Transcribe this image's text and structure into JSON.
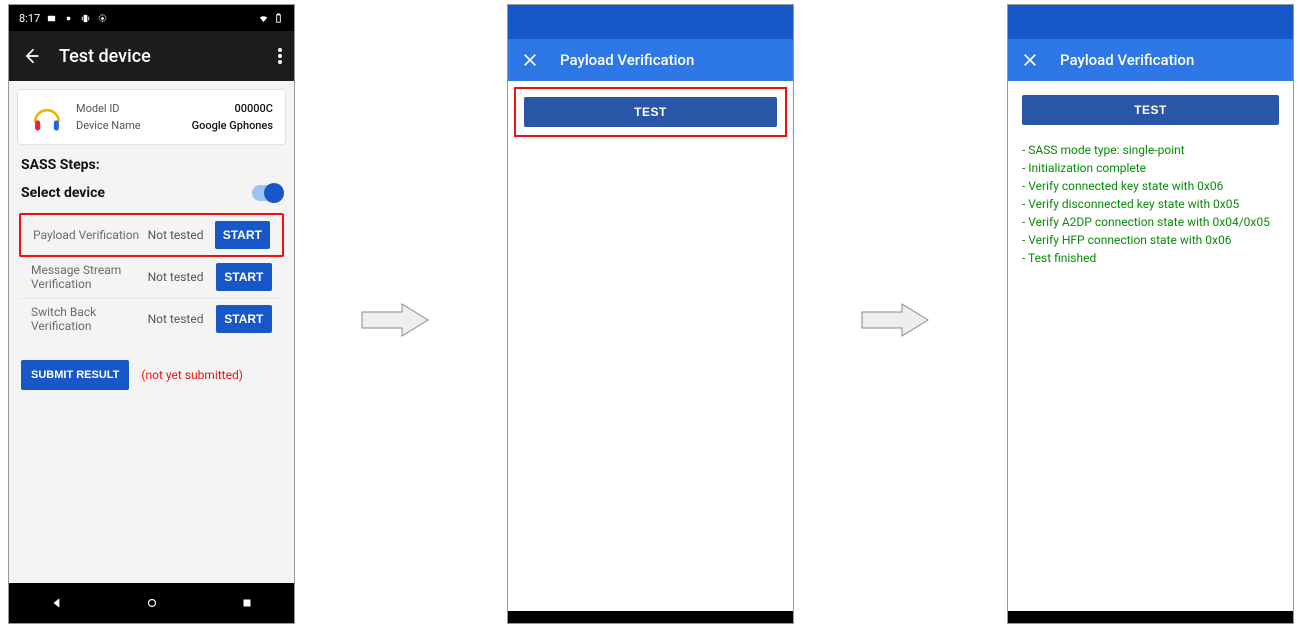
{
  "statusbar": {
    "time": "8:17"
  },
  "titlebar": {
    "title": "Test device"
  },
  "device_card": {
    "model_id_label": "Model ID",
    "model_id_value": "00000C",
    "device_name_label": "Device Name",
    "device_name_value": "Google Gphones"
  },
  "sections": {
    "sass_steps": "SASS Steps:",
    "select_device": "Select device"
  },
  "steps": [
    {
      "name": "Payload Verification",
      "status": "Not tested",
      "button": "START"
    },
    {
      "name": "Message Stream Verification",
      "status": "Not tested",
      "button": "START"
    },
    {
      "name": "Switch Back Verification",
      "status": "Not tested",
      "button": "START"
    }
  ],
  "submit": {
    "button": "SUBMIT RESULT",
    "status": "(not yet submitted)"
  },
  "screen2": {
    "title": "Payload Verification",
    "test_button": "TEST"
  },
  "screen3": {
    "title": "Payload Verification",
    "test_button": "TEST",
    "results": [
      "- SASS mode type: single-point",
      "- Initialization complete",
      "- Verify connected key state with 0x06",
      "- Verify disconnected key state with 0x05",
      "- Verify A2DP connection state with 0x04/0x05",
      "- Verify HFP connection state with 0x06",
      "- Test finished"
    ]
  }
}
